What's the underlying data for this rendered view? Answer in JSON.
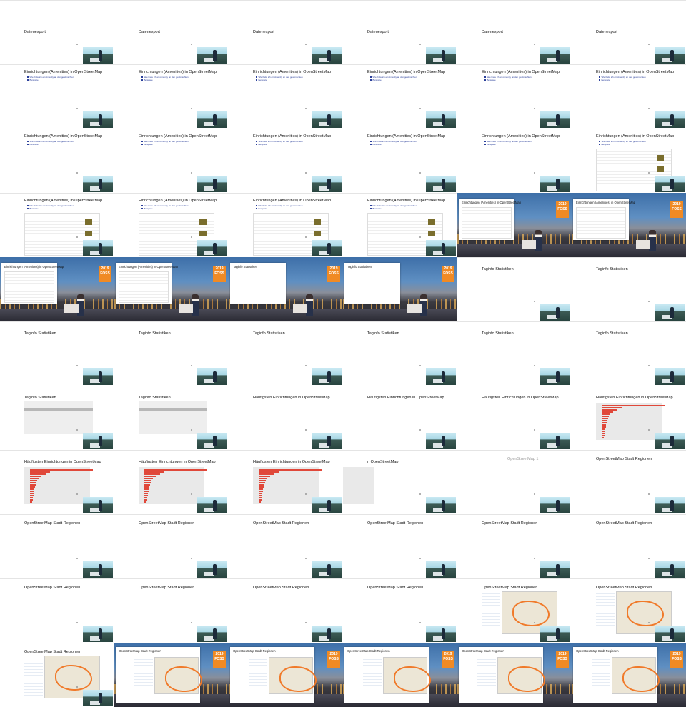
{
  "grid": {
    "columns": 6,
    "rows": 11
  },
  "badge": {
    "text": "2019 FOSS",
    "color": "#f08a24"
  },
  "slides": {
    "datenexport": "Datenexport",
    "amenities": "Einrichtungen (Amenities) in OpenStreetMap",
    "taginfo": "Taginfo Statistiken",
    "haeufigste": "Häufigsten Einrichtungen in OpenStreetMap",
    "osm_stadt": "OpenStreetMap Stadt Regionen",
    "amenities_short": "Einrichtungen (Amenities) in OpenStreetMap"
  },
  "bullets": {
    "b1": "Wie finde ich ein Amenity an den gewünschten",
    "b2": "Beispiele"
  },
  "fragments": {
    "osm_partial": "n OpenStreetMap",
    "osm_number": "OpenStreetMap 1"
  }
}
